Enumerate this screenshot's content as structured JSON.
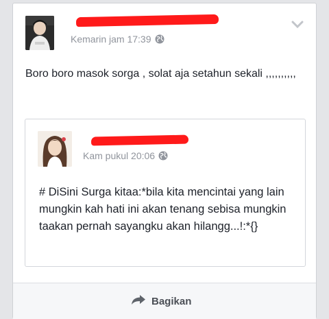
{
  "post": {
    "timestamp": "Kemarin jam 17:39",
    "privacy_icon": "globe-icon",
    "options_icon": "chevron-down-icon",
    "text": "Boro boro masok sorga , solat aja setahun sekali ,,,,,,,,,,"
  },
  "shared_post": {
    "timestamp": "Kam pukul 20:06",
    "privacy_icon": "globe-icon",
    "text": "# DiSini Surga kitaa:*bila kita mencintai yang lain mungkin kah hati ini akan tenang sebisa mungkin taakan pernah sayangku akan hilangg...!:*{}"
  },
  "footer": {
    "share_label": "Bagikan",
    "share_icon": "share-arrow-icon"
  },
  "colors": {
    "redaction": "#ff1a1a",
    "meta_text": "#90949c",
    "body_text": "#1d2129"
  }
}
